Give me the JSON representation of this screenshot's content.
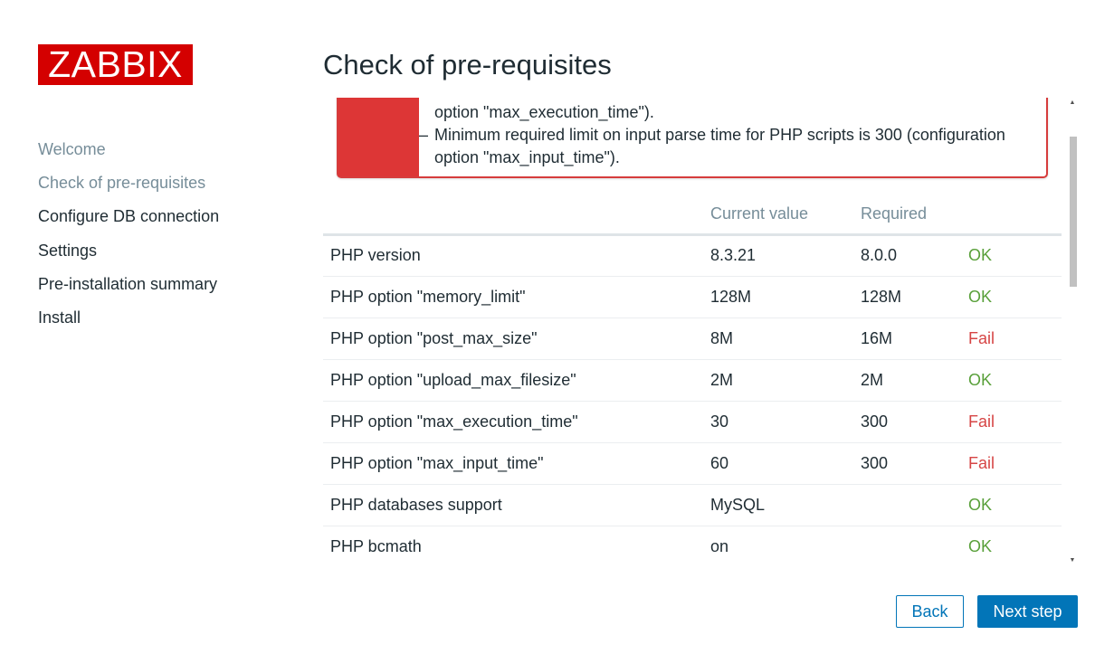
{
  "brand": {
    "logo_text": "ZABBIX",
    "logo_color": "#d40000"
  },
  "nav": {
    "items": [
      {
        "label": "Welcome",
        "state": "done"
      },
      {
        "label": "Check of pre-requisites",
        "state": "current"
      },
      {
        "label": "Configure DB connection",
        "state": "pending"
      },
      {
        "label": "Settings",
        "state": "pending"
      },
      {
        "label": "Pre-installation summary",
        "state": "pending"
      },
      {
        "label": "Install",
        "state": "pending"
      }
    ]
  },
  "page": {
    "title": "Check of pre-requisites"
  },
  "message": {
    "type": "error",
    "color": "#dd3636",
    "lines": [
      "option \"max_execution_time\").",
      "Minimum required limit on input parse time for PHP scripts is 300 (configuration",
      "option \"max_input_time\")."
    ]
  },
  "table": {
    "headers": {
      "name": "",
      "current": "Current value",
      "required": "Required",
      "result": ""
    },
    "rows": [
      {
        "name": "PHP version",
        "current": "8.3.21",
        "required": "8.0.0",
        "result": "OK"
      },
      {
        "name": "PHP option \"memory_limit\"",
        "current": "128M",
        "required": "128M",
        "result": "OK"
      },
      {
        "name": "PHP option \"post_max_size\"",
        "current": "8M",
        "required": "16M",
        "result": "Fail"
      },
      {
        "name": "PHP option \"upload_max_filesize\"",
        "current": "2M",
        "required": "2M",
        "result": "OK"
      },
      {
        "name": "PHP option \"max_execution_time\"",
        "current": "30",
        "required": "300",
        "result": "Fail"
      },
      {
        "name": "PHP option \"max_input_time\"",
        "current": "60",
        "required": "300",
        "result": "Fail"
      },
      {
        "name": "PHP databases support",
        "current": "MySQL",
        "required": "",
        "result": "OK"
      },
      {
        "name": "PHP bcmath",
        "current": "on",
        "required": "",
        "result": "OK"
      }
    ]
  },
  "status_colors": {
    "ok": "#59a03a",
    "fail": "#d64545"
  },
  "buttons": {
    "back": "Back",
    "next": "Next step",
    "accent": "#0275b8"
  }
}
